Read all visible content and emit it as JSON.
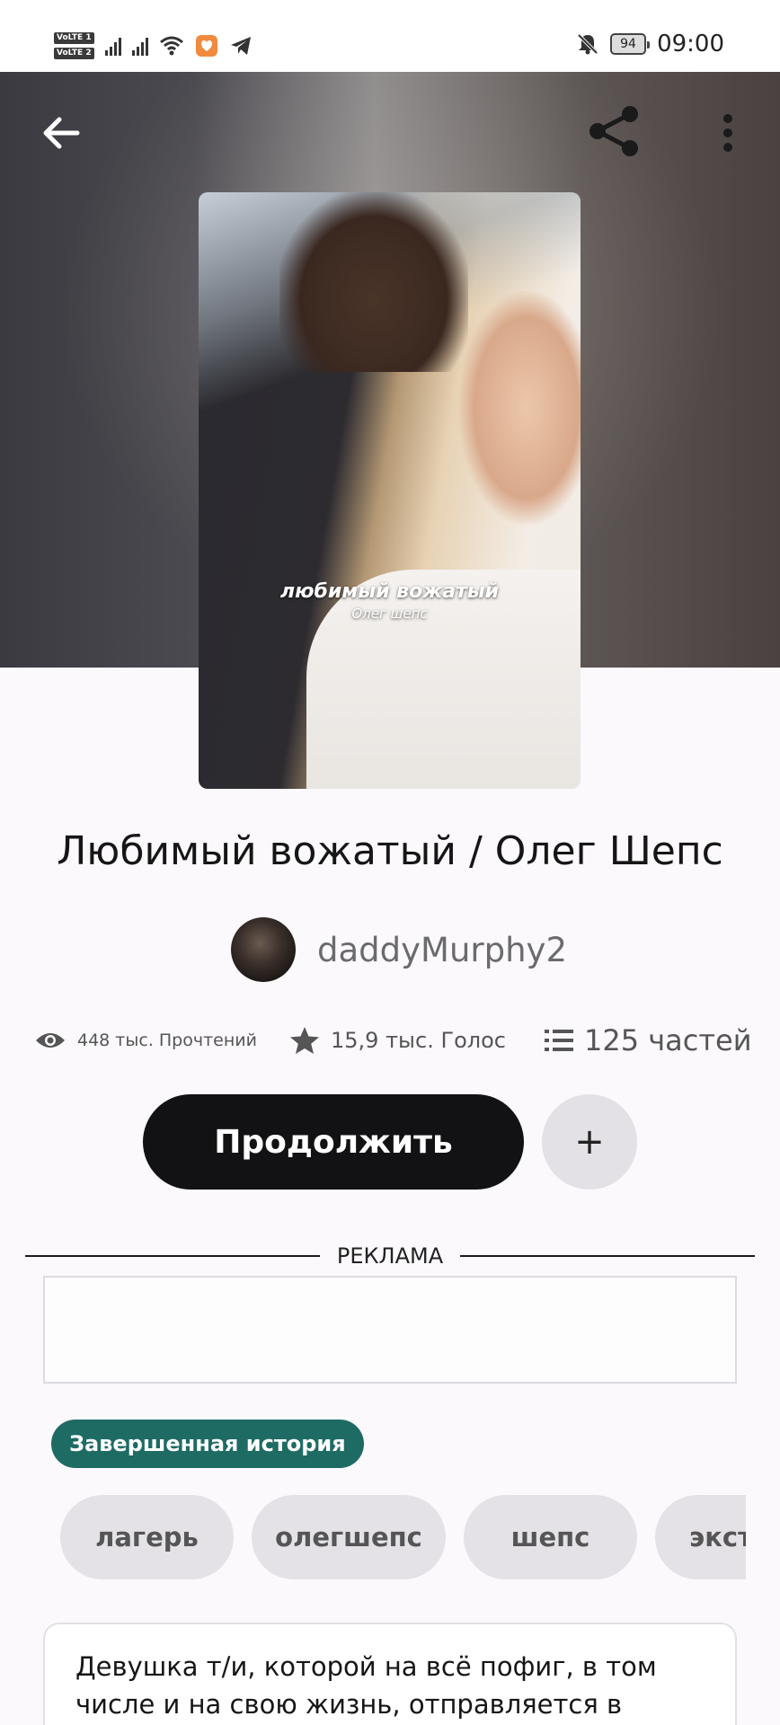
{
  "status_bar": {
    "volte1": "VoLTE 1",
    "volte2": "VoLTE 2",
    "battery": "94",
    "time": "09:00",
    "icons": [
      "signal-icon",
      "signal-icon",
      "wifi-icon",
      "heart-shield-icon",
      "telegram-icon",
      "bell-off-icon"
    ]
  },
  "toolbar": {
    "back_icon": "arrow-left-icon",
    "share_icon": "share-icon",
    "more_icon": "more-vertical-icon"
  },
  "cover": {
    "title": "любимый вожатый",
    "subtitle": "Олег шепс"
  },
  "story": {
    "title": "Любимый вожатый / Олег Шепс",
    "author": "daddyMurphy2",
    "stats": {
      "reads": "448 тыс. Прочтений",
      "votes": "15,9 тыс. Голос",
      "parts": "125 частей"
    },
    "continue_label": "Продолжить",
    "add_label": "+"
  },
  "ad": {
    "label": "РЕКЛАМА"
  },
  "status_badge": "Завершенная история",
  "tags": [
    "лагерь",
    "олегшепс",
    "шепс",
    "экст"
  ],
  "description": "Девушка т/и, которой на всё пофиг, в том числе и на свою жизнь, отправляется в",
  "colors": {
    "accent": "#1e6b64",
    "primary_button": "#121214",
    "tag_bg": "#e4e2e7"
  }
}
